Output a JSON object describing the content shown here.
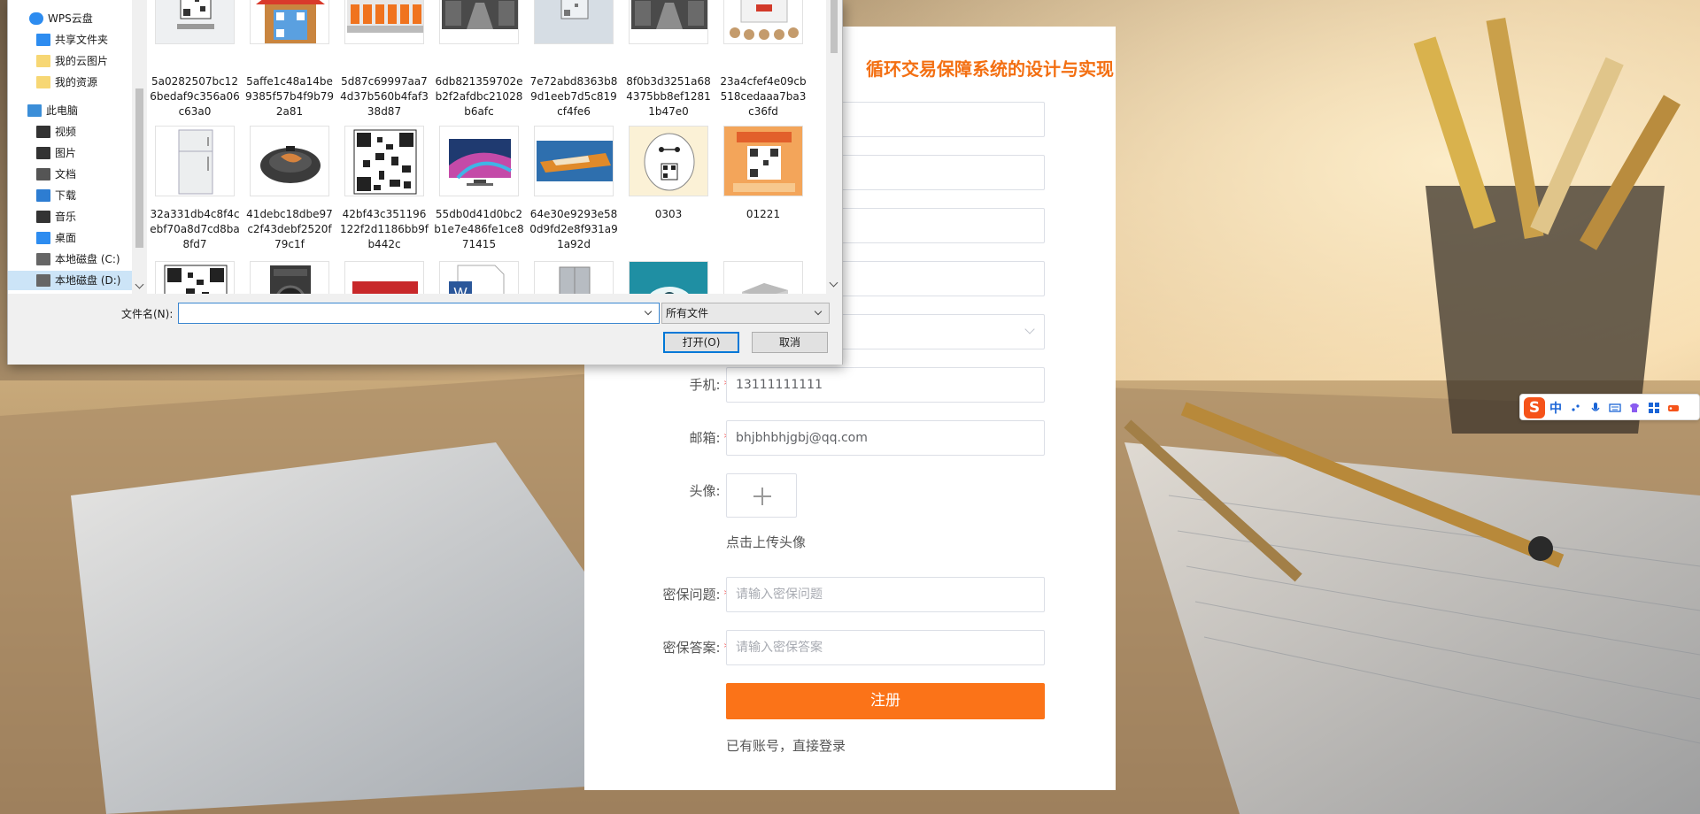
{
  "form": {
    "title": "循环交易保障系统的设计与实现",
    "phone": {
      "label": "手机:",
      "value": "13111111111"
    },
    "email": {
      "label": "邮箱:",
      "value": "bhjbhbhjgbj@qq.com"
    },
    "avatar": {
      "label": "头像:",
      "hint": "点击上传头像"
    },
    "security_question": {
      "label": "密保问题:",
      "placeholder": "请输入密保问题"
    },
    "security_answer": {
      "label": "密保答案:",
      "placeholder": "请输入密保答案"
    },
    "required_mark": "*",
    "register_label": "注册",
    "login_link": "已有账号，直接登录"
  },
  "dialog": {
    "nav": [
      {
        "label": "WPS云盘",
        "icon": "cloud-icon"
      },
      {
        "label": "共享文件夹",
        "icon": "shared-folder-icon"
      },
      {
        "label": "我的云图片",
        "icon": "folder-icon"
      },
      {
        "label": "我的资源",
        "icon": "folder-icon"
      },
      {
        "label": "此电脑",
        "icon": "computer-icon"
      },
      {
        "label": "视频",
        "icon": "video-icon"
      },
      {
        "label": "图片",
        "icon": "pictures-icon"
      },
      {
        "label": "文档",
        "icon": "documents-icon"
      },
      {
        "label": "下载",
        "icon": "download-icon"
      },
      {
        "label": "音乐",
        "icon": "music-icon"
      },
      {
        "label": "桌面",
        "icon": "desktop-icon"
      },
      {
        "label": "本地磁盘 (C:)",
        "icon": "drive-icon"
      },
      {
        "label": "本地磁盘 (D:)",
        "icon": "drive-icon",
        "selected": true
      }
    ],
    "files": [
      {
        "name": "5a0282507bc126bedaf9c356a06c63a0",
        "kind": "qr-poster"
      },
      {
        "name": "5affe1c48a14be9385f57b4f9b792a81",
        "kind": "qr-house"
      },
      {
        "name": "5d87c69997aa74d37b560b4faf338d87",
        "kind": "warehouse"
      },
      {
        "name": "6db821359702eb2f2afdbc21028b6afc",
        "kind": "warehouse-inside"
      },
      {
        "name": "7e72abd8363b89d1eeb7d5c819cf4fe6",
        "kind": "qr-gray"
      },
      {
        "name": "8f0b3d3251a684375bb8ef12811b47e0",
        "kind": "warehouse-inside"
      },
      {
        "name": "23a4cfef4e09cb518cedaaa7ba3c36fd",
        "kind": "rice-cooker"
      },
      {
        "name": "32a331db4c8f4cebf70a8d7cd8ba8fd7",
        "kind": "fridge"
      },
      {
        "name": "41debc18dbe97c2f43debf2520f79c1f",
        "kind": "pan"
      },
      {
        "name": "42bf43c351196122f2d1186bb9fb442c",
        "kind": "qr-code"
      },
      {
        "name": "55db0d41d0bc2b1e7e486fe1ce871415",
        "kind": "tv"
      },
      {
        "name": "64e30e9293e580d9fd2e8f931a91a92d",
        "kind": "boat"
      },
      {
        "name": "0303",
        "kind": "baymax"
      },
      {
        "name": "01221",
        "kind": "qr-poster-orange"
      },
      {
        "name": "",
        "kind": "qr-code"
      },
      {
        "name": "",
        "kind": "washer"
      },
      {
        "name": "",
        "kind": "red-device"
      },
      {
        "name": "",
        "kind": "word-doc"
      },
      {
        "name": "",
        "kind": "fridge-gray"
      },
      {
        "name": "",
        "kind": "teal-image"
      },
      {
        "name": "",
        "kind": "gray-box"
      }
    ],
    "filename_label": "文件名(N):",
    "filename_value": "",
    "filetype": "所有文件",
    "open_label": "打开(O)",
    "cancel_label": "取消"
  },
  "ime": {
    "logo": "S",
    "mode": "中",
    "icons": [
      "punct-icon",
      "mic-icon",
      "keyboard-icon",
      "skin-icon",
      "grid-icon",
      "tool-icon"
    ]
  },
  "colors": {
    "accent": "#fb7318",
    "title": "#f36f12",
    "required": "#f56c6c",
    "selection": "#cce4f7"
  }
}
